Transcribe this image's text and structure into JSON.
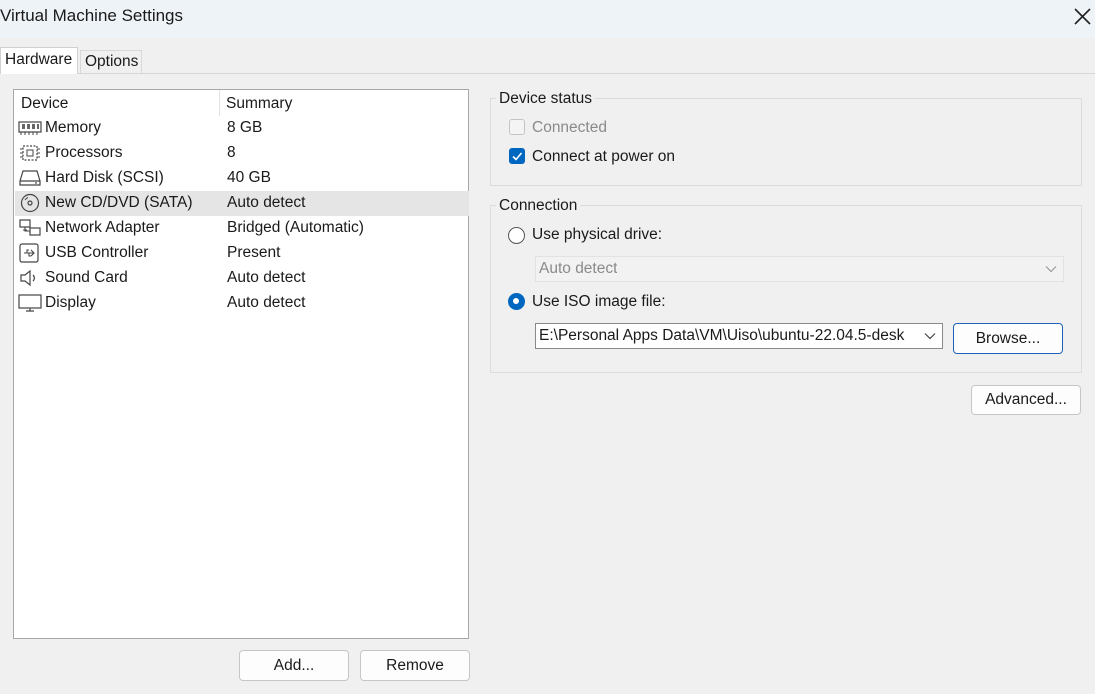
{
  "window": {
    "title": "Virtual Machine Settings"
  },
  "tabs": [
    {
      "label": "Hardware",
      "active": true
    },
    {
      "label": "Options",
      "active": false
    }
  ],
  "device_list": {
    "columns": [
      "Device",
      "Summary"
    ],
    "rows": [
      {
        "device": "Memory",
        "summary": "8 GB",
        "icon": "memory-icon"
      },
      {
        "device": "Processors",
        "summary": "8",
        "icon": "processor-icon"
      },
      {
        "device": "Hard Disk (SCSI)",
        "summary": "40 GB",
        "icon": "hard-disk-icon"
      },
      {
        "device": "New CD/DVD (SATA)",
        "summary": "Auto detect",
        "icon": "cd-dvd-icon",
        "selected": true
      },
      {
        "device": "Network Adapter",
        "summary": "Bridged (Automatic)",
        "icon": "network-adapter-icon"
      },
      {
        "device": "USB Controller",
        "summary": "Present",
        "icon": "usb-icon"
      },
      {
        "device": "Sound Card",
        "summary": "Auto detect",
        "icon": "speaker-icon"
      },
      {
        "device": "Display",
        "summary": "Auto detect",
        "icon": "display-icon"
      }
    ],
    "add_label": "Add...",
    "remove_label": "Remove"
  },
  "device_status": {
    "title": "Device status",
    "connected": {
      "label": "Connected",
      "checked": false,
      "disabled": true
    },
    "connect_power_on": {
      "label": "Connect at power on",
      "checked": true
    }
  },
  "connection": {
    "title": "Connection",
    "physical_drive": {
      "label": "Use physical drive:",
      "selected": false,
      "value": "Auto detect"
    },
    "iso_image": {
      "label": "Use ISO image file:",
      "selected": true,
      "value": "E:\\Personal Apps Data\\VM\\Uiso\\ubuntu-22.04.5-desk"
    },
    "browse_label": "Browse..."
  },
  "advanced_label": "Advanced...",
  "colors": {
    "accent": "#0067c0",
    "selection": "#e5e5e5",
    "titlebar": "#eef3f8"
  }
}
